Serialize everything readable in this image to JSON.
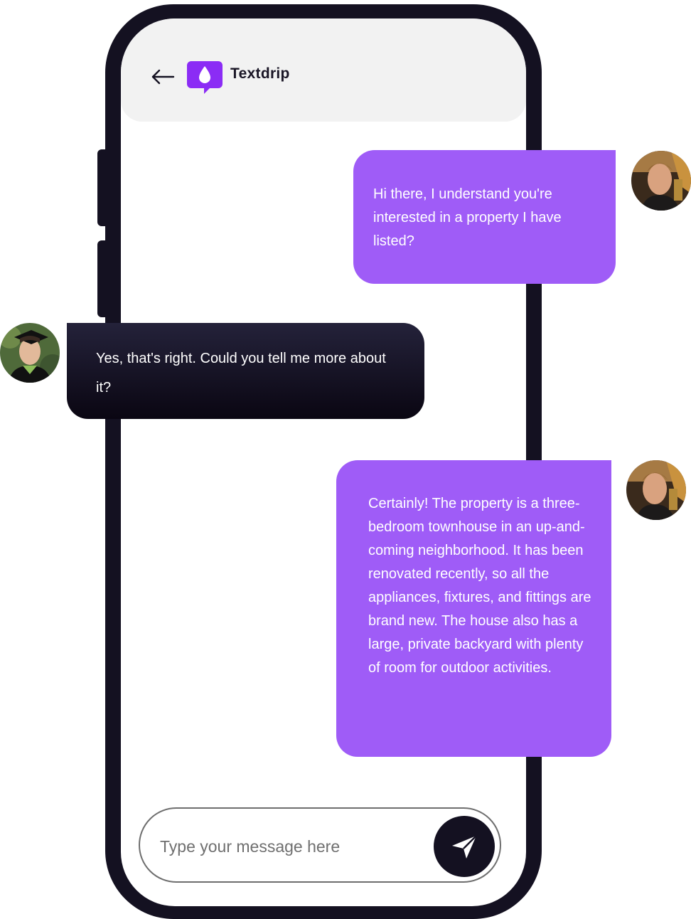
{
  "header": {
    "back_icon": "arrow-left-icon",
    "logo_icon": "drop-chat-logo-icon",
    "app_name": "Textdrip"
  },
  "messages": [
    {
      "sender": "agent",
      "text": "Hi there, I understand you're interested in a property I have listed?"
    },
    {
      "sender": "customer",
      "text": "Yes, that's right. Could you tell me more about it?"
    },
    {
      "sender": "agent",
      "text": "Certainly! The property is a three-bedroom townhouse in an up-and-coming neighborhood. It has been renovated recently, so all the appliances, fixtures, and fittings are brand new. The house also has a large, private backyard with plenty of room for outdoor activities."
    }
  ],
  "composer": {
    "placeholder": "Type your message here",
    "value": "",
    "send_icon": "paper-plane-icon"
  },
  "colors": {
    "phone_frame": "#141121",
    "agent_bubble": "#9f5cf7",
    "customer_bubble": "#141121",
    "logo": "#8b2cf5",
    "header_bg": "#f2f2f2"
  }
}
